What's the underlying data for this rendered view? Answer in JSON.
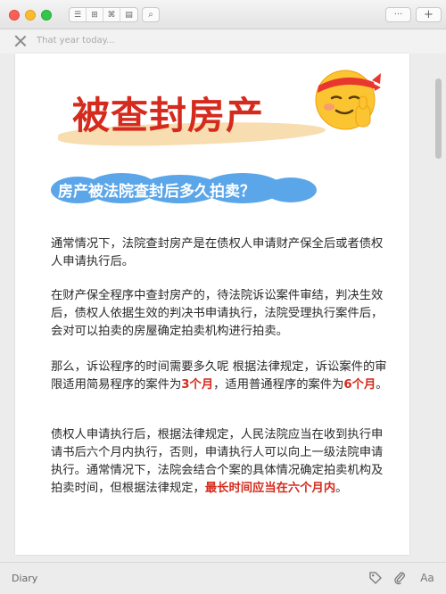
{
  "window": {
    "toolbar_segments": [
      "☰",
      "⊞",
      "⌘",
      "▤"
    ],
    "search_glyph": "⌕",
    "more_label": "···",
    "add_label": "+"
  },
  "entry": {
    "placeholder": "That year today..."
  },
  "document": {
    "banner_title": "被查封房产",
    "section_heading": "房产被法院查封后多久拍卖？",
    "paragraphs": [
      [
        "通常情况下，法院查封房产是在债权人申请财产保全后或者债权人申请执行后。"
      ],
      [
        "在财产保全程序中查封房产的，待法院诉讼案件审结，判决生效后，债权人依据生效的判决书申请执行，法院受理执行案件后，会对可以拍卖的房屋确定拍卖机构进行拍卖。"
      ],
      [
        "那么，诉讼程序的时间需要多久呢 根据法律规定，诉讼案件的审限适用简易程序的案件为",
        "3个月",
        "，适用普通程序的案件为",
        "6个月",
        "。"
      ],
      [
        "债权人申请执行后，根据法律规定，人民法院应当在收到执行申请书后六个月内执行，否则，申请执行人可以向上一级法院申请执行。通常情况下，法院会结合个案的具体情况确定拍卖机构及拍卖时间，但根据法律规定，",
        "最长时间应当在六个月内",
        "。"
      ]
    ]
  },
  "footer": {
    "journal_name": "Diary",
    "text_button_label": "Aa"
  },
  "colors": {
    "accent_red": "#d52b1e",
    "cloud_blue": "#5ba6e8",
    "brush_tan": "#f6d9a6"
  },
  "icons": [
    "close-icon",
    "tag-icon",
    "paperclip-icon",
    "text-format-icon",
    "search-icon",
    "list-view-icon",
    "grid-view-icon",
    "map-view-icon",
    "calendar-view-icon"
  ]
}
